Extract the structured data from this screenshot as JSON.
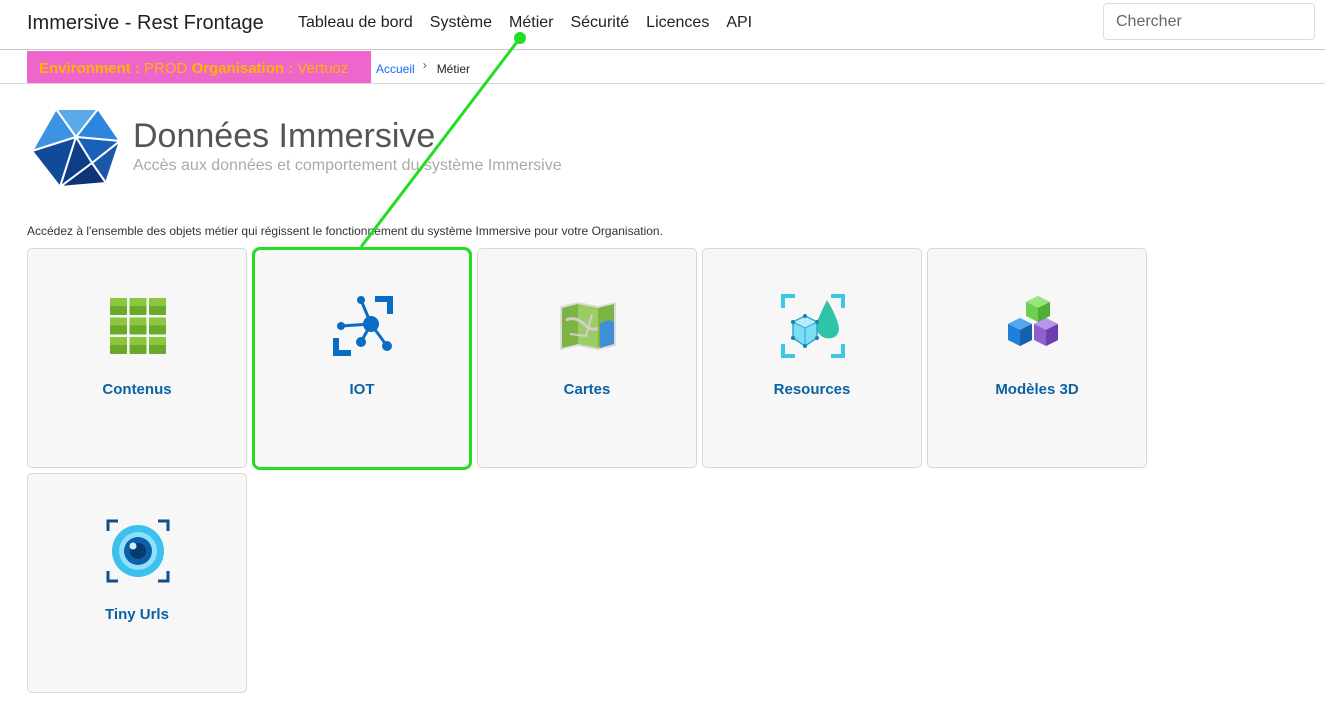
{
  "navbar": {
    "brand": "Immersive - Rest Frontage",
    "items": [
      {
        "label": "Tableau de bord"
      },
      {
        "label": "Système"
      },
      {
        "label": "Métier"
      },
      {
        "label": "Sécurité"
      },
      {
        "label": "Licences"
      },
      {
        "label": "API"
      }
    ],
    "search_placeholder": "Chercher"
  },
  "env": {
    "env_label": "Environment :",
    "env_value": "PROD",
    "org_label": "Organisation :",
    "org_value": "Vertuoz"
  },
  "breadcrumb": {
    "home": "Accueil",
    "current": "Métier"
  },
  "header": {
    "title": "Données Immersive",
    "subtitle": "Accès aux données et comportement du système Immersive",
    "intro": "Accédez à l'ensemble des objets métier qui régissent le fonctionnement du système Immersive pour votre Organisation."
  },
  "tiles": [
    {
      "label": "Contenus",
      "icon": "grid-icon"
    },
    {
      "label": "IOT",
      "icon": "iot-network-icon"
    },
    {
      "label": "Cartes",
      "icon": "map-icon"
    },
    {
      "label": "Resources",
      "icon": "resources-cube-icon"
    },
    {
      "label": "Modèles 3D",
      "icon": "cubes-3d-icon"
    },
    {
      "label": "Tiny Urls",
      "icon": "eye-lens-icon"
    }
  ],
  "colors": {
    "accent_blue": "#0b62a4",
    "env_badge_bg": "#ee66cc",
    "env_badge_text": "#ffb400",
    "annotation_green": "#22dd22"
  }
}
